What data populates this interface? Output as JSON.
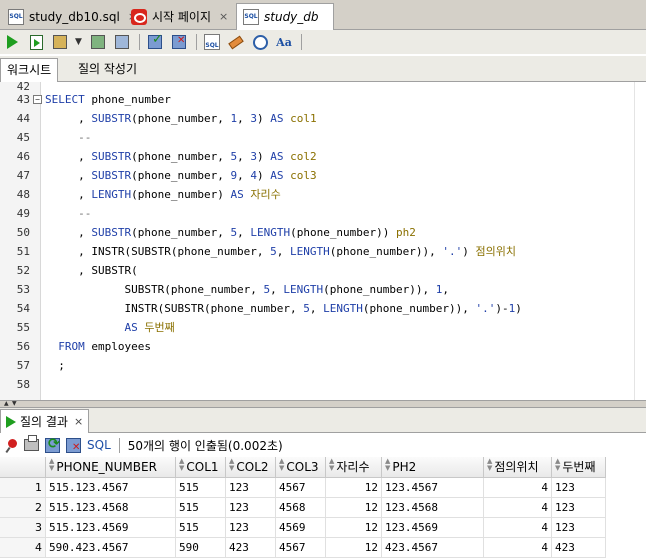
{
  "doc_tabs": [
    {
      "label": "study_db10.sql",
      "icon": "sql-file-icon"
    },
    {
      "label": "시작 페이지",
      "icon": "start-page-icon"
    },
    {
      "label": "study_db",
      "icon": "sql-worksheet-icon"
    }
  ],
  "sub_tabs": [
    "워크시트",
    "질의 작성기"
  ],
  "editor": {
    "top_partial_line": "42",
    "lines": [
      {
        "n": "43",
        "fold": "−",
        "parts": [
          [
            "kw",
            "SELECT"
          ],
          [
            "plain",
            " phone_number"
          ]
        ]
      },
      {
        "n": "44",
        "parts": [
          [
            "plain",
            "     , "
          ],
          [
            "fn",
            "SUBSTR"
          ],
          [
            "plain",
            "(phone_number, "
          ],
          [
            "num",
            "1"
          ],
          [
            "plain",
            ", "
          ],
          [
            "num",
            "3"
          ],
          [
            "plain",
            ") "
          ],
          [
            "kw",
            "AS"
          ],
          [
            "plain",
            " "
          ],
          [
            "alias",
            "col1"
          ]
        ]
      },
      {
        "n": "45",
        "parts": [
          [
            "cmt",
            "     --"
          ]
        ]
      },
      {
        "n": "46",
        "parts": [
          [
            "plain",
            "     , "
          ],
          [
            "fn",
            "SUBSTR"
          ],
          [
            "plain",
            "(phone_number, "
          ],
          [
            "num",
            "5"
          ],
          [
            "plain",
            ", "
          ],
          [
            "num",
            "3"
          ],
          [
            "plain",
            ") "
          ],
          [
            "kw",
            "AS"
          ],
          [
            "plain",
            " "
          ],
          [
            "alias",
            "col2"
          ]
        ]
      },
      {
        "n": "47",
        "parts": [
          [
            "plain",
            "     , "
          ],
          [
            "fn",
            "SUBSTR"
          ],
          [
            "plain",
            "(phone_number, "
          ],
          [
            "num",
            "9"
          ],
          [
            "plain",
            ", "
          ],
          [
            "num",
            "4"
          ],
          [
            "plain",
            ") "
          ],
          [
            "kw",
            "AS"
          ],
          [
            "plain",
            " "
          ],
          [
            "alias",
            "col3"
          ]
        ]
      },
      {
        "n": "48",
        "parts": [
          [
            "plain",
            "     , "
          ],
          [
            "fn",
            "LENGTH"
          ],
          [
            "plain",
            "(phone_number) "
          ],
          [
            "kw",
            "AS"
          ],
          [
            "plain",
            " "
          ],
          [
            "alias",
            "자리수"
          ]
        ]
      },
      {
        "n": "49",
        "parts": [
          [
            "cmt",
            "     --"
          ]
        ]
      },
      {
        "n": "50",
        "parts": [
          [
            "plain",
            "     , "
          ],
          [
            "fn",
            "SUBSTR"
          ],
          [
            "plain",
            "(phone_number, "
          ],
          [
            "num",
            "5"
          ],
          [
            "plain",
            ", "
          ],
          [
            "fn",
            "LENGTH"
          ],
          [
            "plain",
            "(phone_number)) "
          ],
          [
            "alias",
            "ph2"
          ]
        ]
      },
      {
        "n": "51",
        "parts": [
          [
            "plain",
            "     , INSTR(SUBSTR(phone_number, "
          ],
          [
            "num",
            "5"
          ],
          [
            "plain",
            ", "
          ],
          [
            "fn",
            "LENGTH"
          ],
          [
            "plain",
            "(phone_number)), "
          ],
          [
            "str",
            "'.'"
          ],
          [
            "plain",
            ") "
          ],
          [
            "alias",
            "점의위치"
          ]
        ]
      },
      {
        "n": "52",
        "parts": [
          [
            "plain",
            "     , SUBSTR("
          ]
        ]
      },
      {
        "n": "53",
        "parts": [
          [
            "plain",
            "            SUBSTR(phone_number, "
          ],
          [
            "num",
            "5"
          ],
          [
            "plain",
            ", "
          ],
          [
            "fn",
            "LENGTH"
          ],
          [
            "plain",
            "(phone_number)), "
          ],
          [
            "num",
            "1"
          ],
          [
            "plain",
            ","
          ]
        ]
      },
      {
        "n": "54",
        "parts": [
          [
            "plain",
            "            INSTR(SUBSTR(phone_number, "
          ],
          [
            "num",
            "5"
          ],
          [
            "plain",
            ", "
          ],
          [
            "fn",
            "LENGTH"
          ],
          [
            "plain",
            "(phone_number)), "
          ],
          [
            "str",
            "'.'"
          ],
          [
            "plain",
            ")-"
          ],
          [
            "num",
            "1"
          ],
          [
            "plain",
            ")"
          ]
        ]
      },
      {
        "n": "55",
        "parts": [
          [
            "plain",
            "            "
          ],
          [
            "kw",
            "AS"
          ],
          [
            "plain",
            " "
          ],
          [
            "alias",
            "두번째"
          ]
        ]
      },
      {
        "n": "56",
        "parts": [
          [
            "plain",
            "  "
          ],
          [
            "kw",
            "FROM"
          ],
          [
            "plain",
            " employees"
          ]
        ]
      },
      {
        "n": "57",
        "parts": [
          [
            "plain",
            "  ;"
          ]
        ]
      },
      {
        "n": "58",
        "parts": []
      }
    ]
  },
  "results": {
    "tab_label": "질의 결과",
    "tab_close": "×",
    "sql_label": "SQL",
    "status": "50개의 행이 인출됨(0.002초)",
    "columns": [
      "PHONE_NUMBER",
      "COL1",
      "COL2",
      "COL3",
      "자리수",
      "PH2",
      "점의위치",
      "두번째"
    ],
    "rows": [
      [
        "1",
        "515.123.4567",
        "515",
        "123",
        "4567",
        "12",
        "123.4567",
        "4",
        "123"
      ],
      [
        "2",
        "515.123.4568",
        "515",
        "123",
        "4568",
        "12",
        "123.4568",
        "4",
        "123"
      ],
      [
        "3",
        "515.123.4569",
        "515",
        "123",
        "4569",
        "12",
        "123.4569",
        "4",
        "123"
      ],
      [
        "4",
        "590.423.4567",
        "590",
        "423",
        "4567",
        "12",
        "423.4567",
        "4",
        "423"
      ]
    ]
  }
}
